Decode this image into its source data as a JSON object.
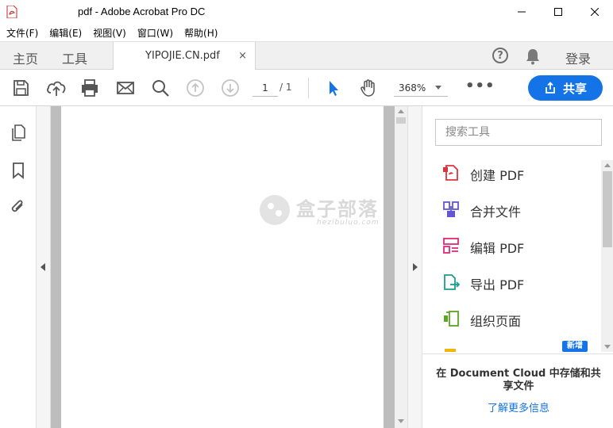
{
  "window": {
    "title": "pdf - Adobe Acrobat Pro DC"
  },
  "menu": [
    "文件(F)",
    "编辑(E)",
    "视图(V)",
    "窗口(W)",
    "帮助(H)"
  ],
  "tabs": {
    "home": "主页",
    "tools": "工具",
    "document": "YIPOJIE.CN.pdf",
    "close": "×"
  },
  "header_right": {
    "help": "?",
    "login": "登录"
  },
  "toolbar": {
    "page_current": "1",
    "page_total": "/ 1",
    "zoom": "368%",
    "more": "•••",
    "share_label": "共享"
  },
  "watermark": {
    "title": "盒子部落",
    "subtitle": "hezibuluo.com"
  },
  "right_pane": {
    "search_placeholder": "搜索工具",
    "tools": [
      {
        "label": "创建 PDF",
        "icon": "create-pdf-icon",
        "color": "#e0323c"
      },
      {
        "label": "合并文件",
        "icon": "combine-files-icon",
        "color": "#6157d3"
      },
      {
        "label": "编辑 PDF",
        "icon": "edit-pdf-icon",
        "color": "#e0287a"
      },
      {
        "label": "导出 PDF",
        "icon": "export-pdf-icon",
        "color": "#1a9c91"
      },
      {
        "label": "组织页面",
        "icon": "organize-pages-icon",
        "color": "#5aa61f"
      }
    ],
    "new_badge": "新增",
    "cloud_text": "在 Document Cloud 中存储和共享文件",
    "learn_more": "了解更多信息"
  },
  "colors": {
    "accent": "#1473e6",
    "tabbar_bg": "#f0f0f0",
    "doc_bg": "#bdbdbd"
  }
}
